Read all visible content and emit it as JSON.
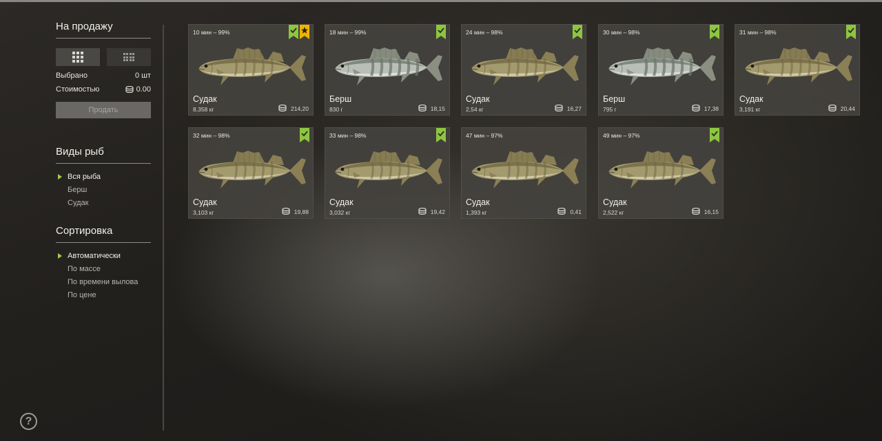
{
  "sidebar": {
    "sale_title": "На продажу",
    "selected_label": "Выбрано",
    "selected_value": "0 шт",
    "cost_label": "Стоимостью",
    "cost_value": "0.00",
    "sell_button": "Продать",
    "species_title": "Виды рыб",
    "species": [
      "Вся рыба",
      "Берш",
      "Судак"
    ],
    "sort_title": "Сортировка",
    "sort_options": [
      "Автоматически",
      "По массе",
      "По времени вылова",
      "По цене"
    ],
    "help": "?"
  },
  "colors": {
    "accent_green": "#8dc63f",
    "star_gold": "#f0b400"
  },
  "cards": [
    {
      "time": "10 мин – 99%",
      "name": "Судак",
      "weight": "8,358 кг",
      "price": "214,20",
      "check": true,
      "star": true,
      "fish": "zander"
    },
    {
      "time": "18 мин – 99%",
      "name": "Берш",
      "weight": "830 г",
      "price": "18,15",
      "check": true,
      "star": false,
      "fish": "bersh"
    },
    {
      "time": "24 мин – 98%",
      "name": "Судак",
      "weight": "2,54 кг",
      "price": "16,27",
      "check": true,
      "star": false,
      "fish": "zander"
    },
    {
      "time": "30 мин – 98%",
      "name": "Берш",
      "weight": "795 г",
      "price": "17,38",
      "check": true,
      "star": false,
      "fish": "bersh"
    },
    {
      "time": "31 мин – 98%",
      "name": "Судак",
      "weight": "3,191 кг",
      "price": "20,44",
      "check": true,
      "star": false,
      "fish": "zander"
    },
    {
      "time": "32 мин – 98%",
      "name": "Судак",
      "weight": "3,103 кг",
      "price": "19,88",
      "check": true,
      "star": false,
      "fish": "zander"
    },
    {
      "time": "33 мин – 98%",
      "name": "Судак",
      "weight": "3,032 кг",
      "price": "19,42",
      "check": true,
      "star": false,
      "fish": "zander"
    },
    {
      "time": "47 мин – 97%",
      "name": "Судак",
      "weight": "1,393 кг",
      "price": "0,41",
      "check": false,
      "star": false,
      "fish": "zander"
    },
    {
      "time": "49 мин – 97%",
      "name": "Судак",
      "weight": "2,522 кг",
      "price": "16,15",
      "check": true,
      "star": false,
      "fish": "zander"
    }
  ]
}
